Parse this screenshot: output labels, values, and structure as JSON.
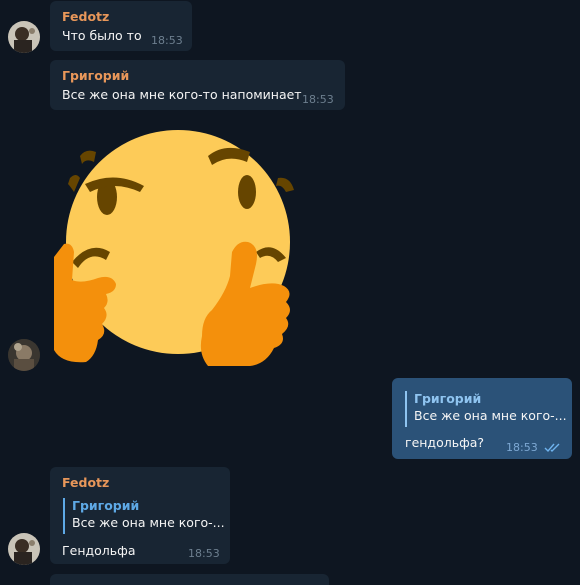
{
  "messages": [
    {
      "sender": "Fedotz",
      "text": "Что было то",
      "time": "18:53"
    },
    {
      "sender": "Григорий",
      "text": "Все же она мне  кого-то напоминает",
      "time": "18:53"
    },
    {
      "sticker": "thinking-face-sticker"
    },
    {
      "reply_name": "Григорий",
      "reply_text": "Все же она мне  кого-...",
      "text": "гендольфа?",
      "time": "18:53",
      "status": "read"
    },
    {
      "sender": "Fedotz",
      "reply_name": "Григорий",
      "reply_text": "Все же она мне  кого-...",
      "text": "Гендольфа",
      "time": "18:53"
    }
  ],
  "colors": {
    "background": "#0e1621",
    "incoming_bubble": "#182533",
    "outgoing_bubble": "#2b5278",
    "sender_name": "#e8975a",
    "reply_accent": "#5ea9e6"
  }
}
